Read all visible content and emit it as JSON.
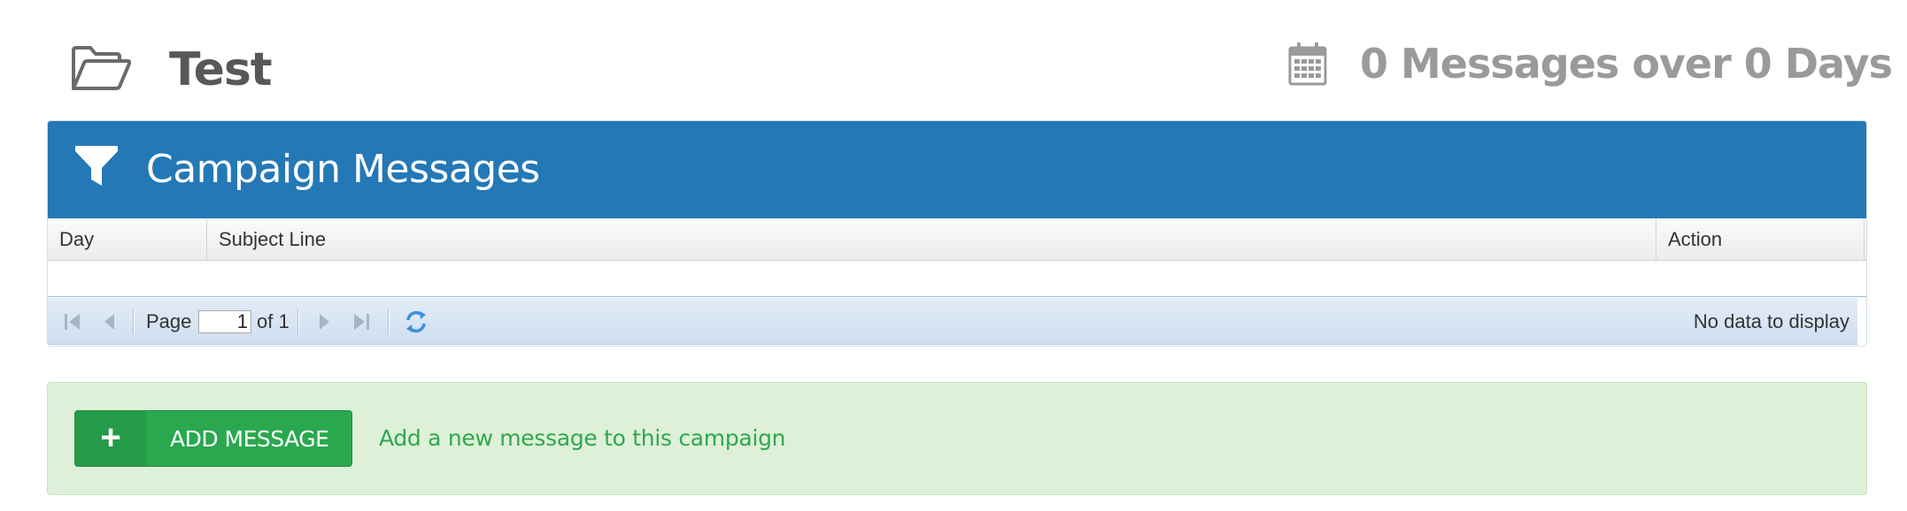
{
  "header": {
    "title": "Test",
    "folder_icon": "folder-open-icon",
    "calendar_icon": "calendar-icon",
    "stats": "0 Messages over 0 Days"
  },
  "panel": {
    "title": "Campaign Messages",
    "filter_icon": "filter-icon",
    "header_color": "#2478b6",
    "columns": {
      "day": "Day",
      "subject": "Subject Line",
      "action": "Action"
    }
  },
  "pager": {
    "page_label": "Page",
    "current_page": "1",
    "of_label": "of 1",
    "status": "No data to display",
    "icons": [
      "first-page-icon",
      "prev-page-icon",
      "next-page-icon",
      "last-page-icon",
      "refresh-icon"
    ]
  },
  "add_message": {
    "button_icon": "+",
    "button_label": "ADD MESSAGE",
    "hint": "Add a new message to this campaign",
    "accent_color": "#2aa84f"
  }
}
